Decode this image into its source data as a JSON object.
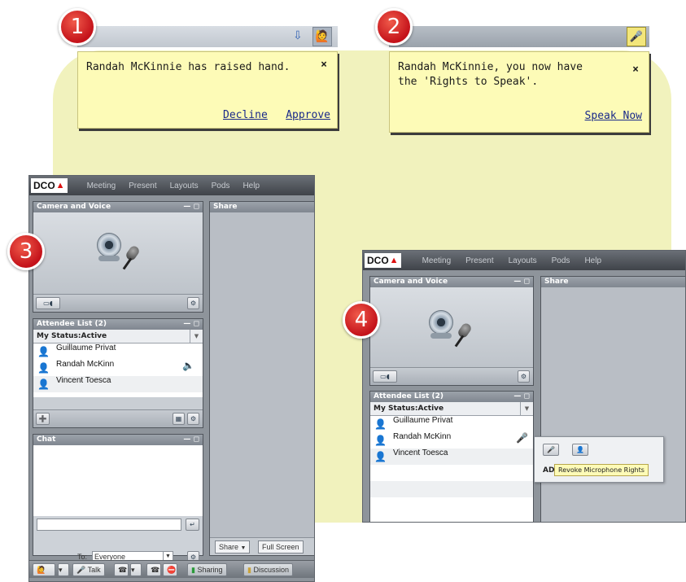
{
  "steps": [
    "1",
    "2",
    "3",
    "4"
  ],
  "notice1": {
    "message": "Randah McKinnie has raised hand.",
    "close": "×",
    "decline": "Decline",
    "approve": "Approve",
    "arrow_icon": "download-arrow-icon",
    "hand_icon": "raise-hand-icon"
  },
  "notice2": {
    "message_line1": "Randah McKinnie, you now have",
    "message_line2": "the 'Rights to Speak'.",
    "close": "×",
    "speak_now": "Speak Now",
    "mic_icon": "microphone-icon"
  },
  "app": {
    "logo": "DCO",
    "menu": [
      "Meeting",
      "Present",
      "Layouts",
      "Pods",
      "Help"
    ],
    "camera_pod_title": "Camera and Voice",
    "share_pod_title": "Share",
    "attendee_pod_title": "Attendee List (2)",
    "my_status": "My Status:Active",
    "attendees": [
      "Guillaume Privat",
      "Randah McKinn",
      "Vincent Toesca"
    ],
    "chat_pod_title": "Chat",
    "to_label": "To:",
    "to_value": "Everyone",
    "share_button": "Share",
    "full_screen": "Full Screen",
    "talk": "Talk",
    "sharing": "Sharing",
    "discussion": "Discussion"
  },
  "revoke_tooltip": "Revoke Microphone Rights",
  "popup_prefix": "AD"
}
